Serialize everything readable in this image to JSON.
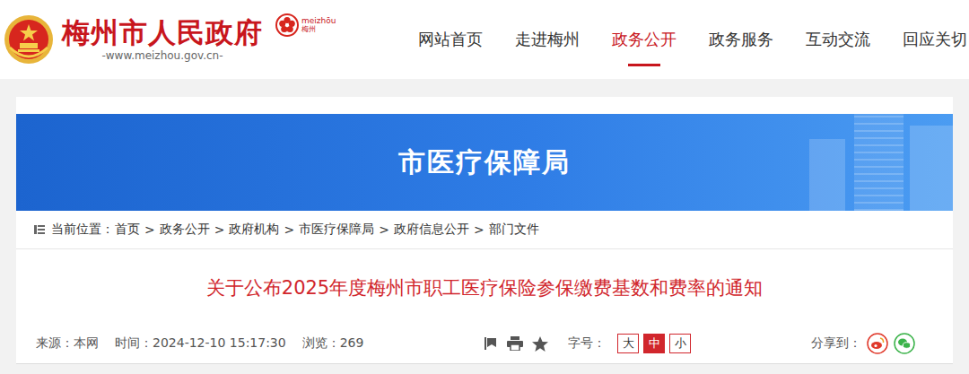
{
  "site": {
    "title": "梅州市人民政府",
    "url": "-www.meizhou.gov.cn-",
    "city_logo": {
      "latin": "meizhōu",
      "chinese": "梅州"
    }
  },
  "nav": [
    {
      "label": "网站首页",
      "selected": false
    },
    {
      "label": "走进梅州",
      "selected": false
    },
    {
      "label": "政务公开",
      "selected": true
    },
    {
      "label": "政务服务",
      "selected": false
    },
    {
      "label": "互动交流",
      "selected": false
    },
    {
      "label": "回应关切",
      "selected": false
    }
  ],
  "banner": {
    "title": "市医疗保障局"
  },
  "breadcrumb": {
    "label": "当前位置：",
    "separator": ">",
    "items": [
      "首页",
      "政务公开",
      "政府机构",
      "市医疗保障局",
      "政府信息公开",
      "部门文件"
    ]
  },
  "article": {
    "title": "关于公布2025年度梅州市职工医疗保险参保缴费基数和费率的通知",
    "meta": [
      {
        "label": "来源：",
        "value": "本网"
      },
      {
        "label": "时间：",
        "value": "2024-12-10 15:17:30"
      },
      {
        "label": "浏览：",
        "value": "269"
      }
    ],
    "font_size": {
      "label": "字号：",
      "options": [
        {
          "label": "大",
          "selected": false
        },
        {
          "label": "中",
          "selected": true
        },
        {
          "label": "小",
          "selected": false
        }
      ]
    },
    "share": {
      "label": "分享到："
    }
  }
}
